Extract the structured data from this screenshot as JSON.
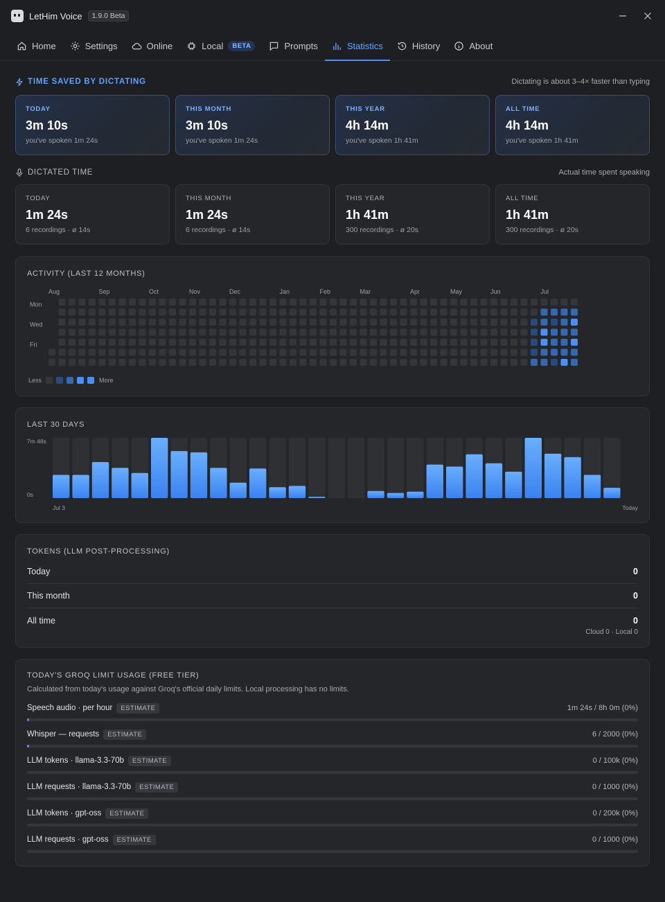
{
  "app": {
    "title": "LetHim Voice",
    "version": "1.9.0 Beta"
  },
  "tabs": [
    {
      "label": "Home",
      "icon": "home-icon"
    },
    {
      "label": "Settings",
      "icon": "gear-icon"
    },
    {
      "label": "Online",
      "icon": "cloud-icon"
    },
    {
      "label": "Local",
      "icon": "chip-icon",
      "badge": "BETA"
    },
    {
      "label": "Prompts",
      "icon": "message-icon"
    },
    {
      "label": "Statistics",
      "icon": "bar-chart-icon",
      "active": true
    },
    {
      "label": "History",
      "icon": "history-icon"
    },
    {
      "label": "About",
      "icon": "info-icon"
    }
  ],
  "time_saved": {
    "title": "TIME SAVED BY DICTATING",
    "note": "Dictating is about 3–4× faster than typing",
    "cards": [
      {
        "label": "TODAY",
        "value": "3m 10s",
        "sub": "you've spoken 1m 24s"
      },
      {
        "label": "THIS MONTH",
        "value": "3m 10s",
        "sub": "you've spoken 1m 24s"
      },
      {
        "label": "THIS YEAR",
        "value": "4h 14m",
        "sub": "you've spoken 1h 41m"
      },
      {
        "label": "ALL TIME",
        "value": "4h 14m",
        "sub": "you've spoken 1h 41m"
      }
    ]
  },
  "dictated": {
    "title": "DICTATED TIME",
    "note": "Actual time spent speaking",
    "cards": [
      {
        "label": "TODAY",
        "value": "1m 24s",
        "sub": "6 recordings · ø 14s"
      },
      {
        "label": "THIS MONTH",
        "value": "1m 24s",
        "sub": "6 recordings · ø 14s"
      },
      {
        "label": "THIS YEAR",
        "value": "1h 41m",
        "sub": "300 recordings · ø 20s"
      },
      {
        "label": "ALL TIME",
        "value": "1h 41m",
        "sub": "300 recordings · ø 20s"
      }
    ]
  },
  "activity": {
    "title": "ACTIVITY (LAST 12 MONTHS)",
    "months": [
      {
        "label": "Aug",
        "week": 0
      },
      {
        "label": "Sep",
        "week": 5
      },
      {
        "label": "Oct",
        "week": 10
      },
      {
        "label": "Nov",
        "week": 14
      },
      {
        "label": "Dec",
        "week": 18
      },
      {
        "label": "Jan",
        "week": 23
      },
      {
        "label": "Feb",
        "week": 27
      },
      {
        "label": "Mar",
        "week": 31
      },
      {
        "label": "Apr",
        "week": 36
      },
      {
        "label": "May",
        "week": 40
      },
      {
        "label": "Jun",
        "week": 44
      },
      {
        "label": "Jul",
        "week": 49
      }
    ],
    "day_labels": [
      "Mon",
      "Wed",
      "Fri"
    ],
    "legend_less": "Less",
    "legend_more": "More",
    "weeks": 53,
    "active_cells": [
      {
        "week": 48,
        "day": 2,
        "level": 1
      },
      {
        "week": 48,
        "day": 3,
        "level": 1
      },
      {
        "week": 48,
        "day": 4,
        "level": 1
      },
      {
        "week": 48,
        "day": 5,
        "level": 1
      },
      {
        "week": 48,
        "day": 6,
        "level": 2
      },
      {
        "week": 48,
        "day": 7,
        "level": 2
      },
      {
        "week": 49,
        "day": 1,
        "level": 2
      },
      {
        "week": 49,
        "day": 2,
        "level": 2
      },
      {
        "week": 49,
        "day": 3,
        "level": 3
      },
      {
        "week": 49,
        "day": 4,
        "level": 3
      },
      {
        "week": 49,
        "day": 5,
        "level": 2
      },
      {
        "week": 49,
        "day": 6,
        "level": 2
      },
      {
        "week": 49,
        "day": 7,
        "level": 2
      },
      {
        "week": 50,
        "day": 1,
        "level": 2
      },
      {
        "week": 50,
        "day": 2,
        "level": 1
      },
      {
        "week": 50,
        "day": 3,
        "level": 2
      },
      {
        "week": 50,
        "day": 4,
        "level": 2
      },
      {
        "week": 50,
        "day": 5,
        "level": 2
      },
      {
        "week": 50,
        "day": 6,
        "level": 1
      },
      {
        "week": 50,
        "day": 7,
        "level": 1
      },
      {
        "week": 51,
        "day": 1,
        "level": 2
      },
      {
        "week": 51,
        "day": 2,
        "level": 2
      },
      {
        "week": 51,
        "day": 3,
        "level": 2
      },
      {
        "week": 51,
        "day": 4,
        "level": 2
      },
      {
        "week": 51,
        "day": 5,
        "level": 2
      },
      {
        "week": 51,
        "day": 6,
        "level": 3
      },
      {
        "week": 52,
        "day": 1,
        "level": 2
      },
      {
        "week": 52,
        "day": 2,
        "level": 3
      },
      {
        "week": 52,
        "day": 3,
        "level": 2
      },
      {
        "week": 52,
        "day": 4,
        "level": 3
      },
      {
        "week": 52,
        "day": 5,
        "level": 2
      },
      {
        "week": 52,
        "day": 6,
        "level": 2
      }
    ]
  },
  "chart_data": {
    "type": "bar",
    "title": "LAST 30 DAYS",
    "y_max_label": "7m 48s",
    "y_min_label": "0s",
    "x_start_label": "Jul 3",
    "x_end_label": "Today",
    "ylim": [
      0,
      468
    ],
    "values": [
      180,
      180,
      280,
      235,
      195,
      468,
      365,
      355,
      235,
      120,
      230,
      85,
      95,
      10,
      0,
      0,
      55,
      40,
      50,
      260,
      245,
      340,
      270,
      205,
      468,
      345,
      318,
      180,
      80
    ]
  },
  "tokens": {
    "title": "TOKENS (LLM POST-PROCESSING)",
    "rows": [
      {
        "label": "Today",
        "value": "0"
      },
      {
        "label": "This month",
        "value": "0"
      },
      {
        "label": "All time",
        "value": "0"
      }
    ],
    "footnote": "Cloud 0 · Local 0"
  },
  "groq": {
    "title": "TODAY'S GROQ LIMIT USAGE (FREE TIER)",
    "desc": "Calculated from today's usage against Groq's official daily limits. Local processing has no limits.",
    "estimate_label": "ESTIMATE",
    "limits": [
      {
        "label": "Speech audio · per hour",
        "value": "1m 24s / 8h 0m (0%)",
        "fill": 0.003
      },
      {
        "label": "Whisper — requests",
        "value": "6 / 2000 (0%)",
        "fill": 0.003
      },
      {
        "label": "LLM tokens · llama-3.3-70b",
        "value": "0 / 100k (0%)",
        "fill": 0
      },
      {
        "label": "LLM requests · llama-3.3-70b",
        "value": "0 / 1000 (0%)",
        "fill": 0
      },
      {
        "label": "LLM tokens · gpt-oss",
        "value": "0 / 200k (0%)",
        "fill": 0
      },
      {
        "label": "LLM requests · gpt-oss",
        "value": "0 / 1000 (0%)",
        "fill": 0
      }
    ]
  },
  "colors": {
    "accent": "#4b8fff",
    "bg": "#1e1f22",
    "panel": "#25262a",
    "heat0": "#34363b",
    "heat1": "#2a4a7a",
    "heat2": "#3668b0",
    "heat3": "#4b8fff"
  }
}
